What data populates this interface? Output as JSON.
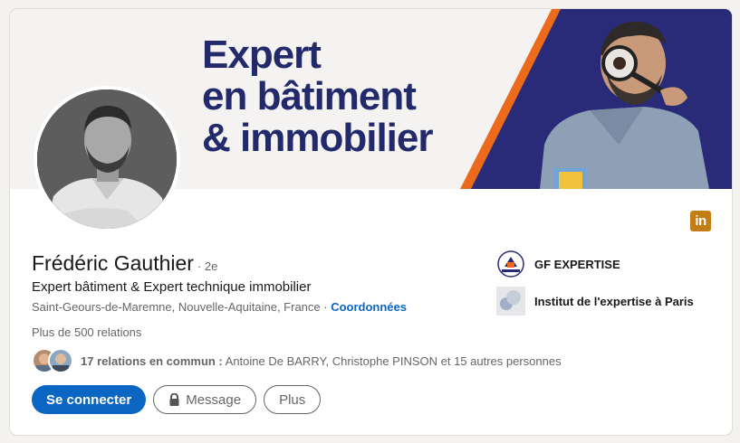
{
  "banner": {
    "line1": "Expert",
    "line2": "en bâtiment",
    "line3": "& immobilier"
  },
  "profile": {
    "name": "Frédéric Gauthier",
    "degree": "· 2e",
    "headline": "Expert bâtiment & Expert technique immobilier",
    "location": "Saint-Geours-de-Maremne, Nouvelle-Aquitaine, France",
    "separator": " · ",
    "contact_link": "Coordonnées",
    "relations": "Plus de 500 relations"
  },
  "mutual": {
    "count_label": "17 relations en commun :",
    "names": " Antoine De BARRY, Christophe PINSON et 15 autres personnes"
  },
  "actions": {
    "connect": "Se connecter",
    "message": "Message",
    "more": "Plus"
  },
  "companies": [
    {
      "name": "GF EXPERTISE",
      "icon": "gf-expertise-logo"
    },
    {
      "name": "Institut de l'expertise à Paris",
      "icon": "institut-logo"
    }
  ],
  "linkedin_badge": "in",
  "colors": {
    "accent": "#0a66c2",
    "banner_text": "#222a6b",
    "banner_navy": "#2a2b78",
    "banner_orange": "#ec6a1c",
    "linkedin_badge": "#c37d16"
  }
}
